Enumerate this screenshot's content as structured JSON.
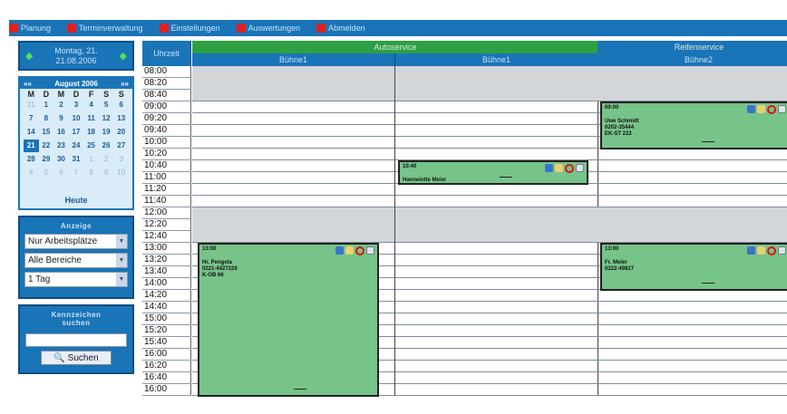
{
  "menu": [
    {
      "label": "Planung"
    },
    {
      "label": "Terminverwaltung"
    },
    {
      "label": "Einstellungen"
    },
    {
      "label": "Auswertungen"
    },
    {
      "label": "Abmelden"
    }
  ],
  "date_panel": {
    "line1": "Montag, 21.",
    "line2": "21.08.2006"
  },
  "calendar": {
    "month_label": "August 2006",
    "prev": "««",
    "next": "»»",
    "weekdays": [
      "M",
      "D",
      "M",
      "D",
      "F",
      "S",
      "S"
    ],
    "days": [
      {
        "d": "31",
        "m": true
      },
      {
        "d": "1"
      },
      {
        "d": "2"
      },
      {
        "d": "3"
      },
      {
        "d": "4"
      },
      {
        "d": "5"
      },
      {
        "d": "6"
      },
      {
        "d": "7"
      },
      {
        "d": "8"
      },
      {
        "d": "9"
      },
      {
        "d": "10"
      },
      {
        "d": "11"
      },
      {
        "d": "12"
      },
      {
        "d": "13"
      },
      {
        "d": "14"
      },
      {
        "d": "15"
      },
      {
        "d": "16"
      },
      {
        "d": "17"
      },
      {
        "d": "18"
      },
      {
        "d": "19"
      },
      {
        "d": "20"
      },
      {
        "d": "21",
        "sel": true
      },
      {
        "d": "22"
      },
      {
        "d": "23"
      },
      {
        "d": "24"
      },
      {
        "d": "25"
      },
      {
        "d": "26"
      },
      {
        "d": "27"
      },
      {
        "d": "28"
      },
      {
        "d": "29"
      },
      {
        "d": "30"
      },
      {
        "d": "31"
      },
      {
        "d": "1",
        "m": true
      },
      {
        "d": "2",
        "m": true
      },
      {
        "d": "3",
        "m": true
      },
      {
        "d": "4",
        "m": true
      },
      {
        "d": "5",
        "m": true
      },
      {
        "d": "6",
        "m": true
      },
      {
        "d": "7",
        "m": true
      },
      {
        "d": "8",
        "m": true
      },
      {
        "d": "9",
        "m": true
      },
      {
        "d": "10",
        "m": true
      }
    ],
    "today_label": "Heute"
  },
  "view_panel": {
    "title": "Anzeige",
    "select1": "Nur Arbeitsplätze",
    "select2": "Alle Bereiche",
    "select3": "1 Tag"
  },
  "search_panel": {
    "title_line1": "Kennzeichen",
    "title_line2": "suchen",
    "button_label": "Suchen",
    "input_value": ""
  },
  "schedule": {
    "time_header": "Uhrzeit",
    "groups": [
      {
        "label": "Autoservice",
        "color": "#2ea043"
      },
      {
        "label": "Reifenservice",
        "color": "#1a74b8"
      }
    ],
    "columns": [
      {
        "label": "Bühne1"
      },
      {
        "label": "Bühne1"
      },
      {
        "label": "Bühne2"
      }
    ],
    "times": [
      "08:00",
      "08:20",
      "08:40",
      "09:00",
      "09:20",
      "09:40",
      "10:00",
      "10:20",
      "10:40",
      "11:00",
      "11:20",
      "11:40",
      "12:00",
      "12:20",
      "12:40",
      "13:00",
      "13:20",
      "13:40",
      "14:00",
      "14:20",
      "14:40",
      "15:00",
      "15:20",
      "15:40",
      "16:00",
      "16:20",
      "16:40",
      "16:00"
    ],
    "appointments": [
      {
        "col": 2,
        "start": 3,
        "end": 7,
        "time": "09:00",
        "line1": "Uwe Schmidt",
        "line2": "0202-35444",
        "line3": "EK-ST 222"
      },
      {
        "col": 1,
        "start": 8,
        "end": 10,
        "time": "10:40",
        "line1": "Hannelotte Meier",
        "line2": "",
        "line3": ""
      },
      {
        "col": 0,
        "start": 15,
        "end": 28,
        "time": "13:00",
        "line1": "Hr. Pengeta",
        "line2": "0221-4427229",
        "line3": "K-GB 66"
      },
      {
        "col": 2,
        "start": 15,
        "end": 19,
        "time": "13:00",
        "line1": "Fr. Meier",
        "line2": "0222-49827",
        "line3": ""
      }
    ],
    "closed_ranges": [
      [
        0,
        3
      ],
      [
        12,
        15
      ]
    ]
  },
  "colors": {
    "accent": "#1a74b8",
    "appointment": "#76c489",
    "menu_marker": "#e02020"
  }
}
